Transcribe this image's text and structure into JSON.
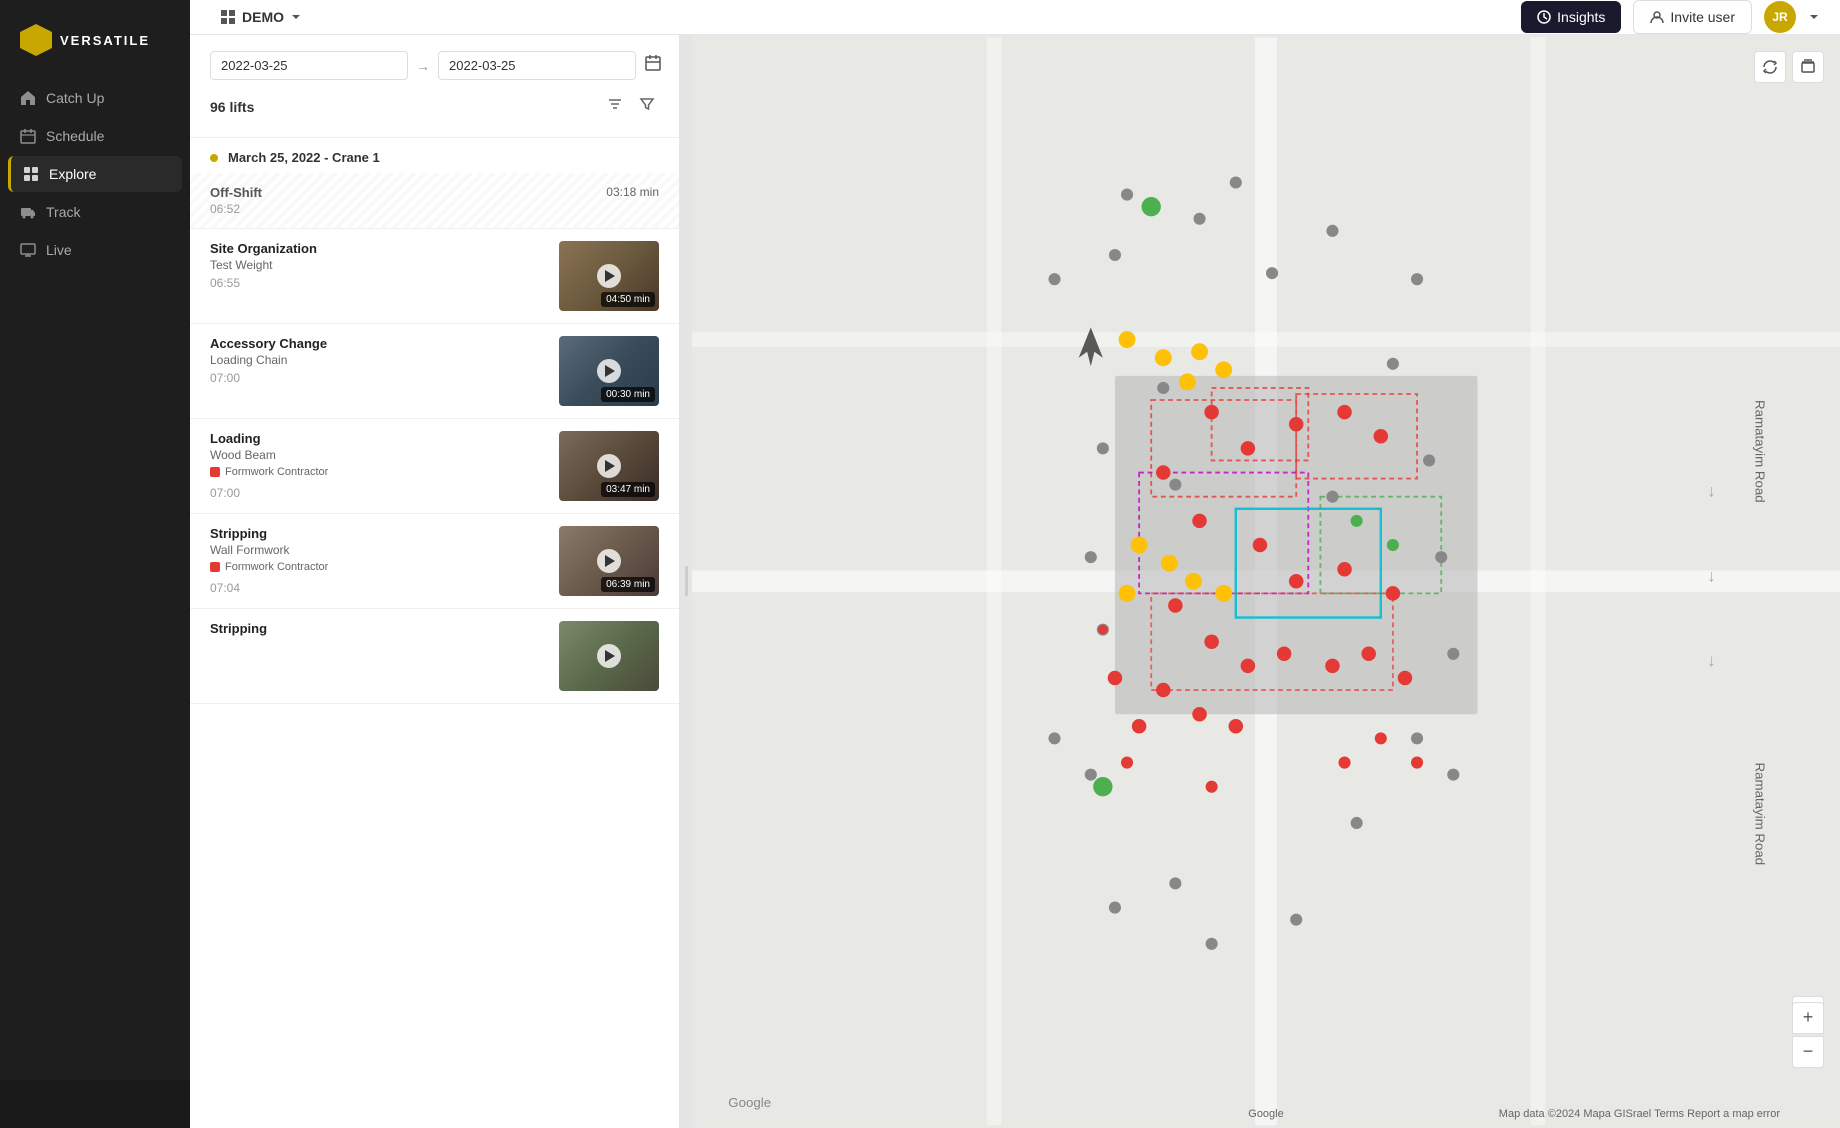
{
  "app": {
    "logo_text": "VERSATILE",
    "project": "DEMO",
    "user_initials": "JR"
  },
  "sidebar": {
    "items": [
      {
        "id": "catch-up",
        "label": "Catch Up",
        "icon": "home"
      },
      {
        "id": "schedule",
        "label": "Schedule",
        "icon": "calendar"
      },
      {
        "id": "explore",
        "label": "Explore",
        "icon": "grid",
        "active": true
      },
      {
        "id": "track",
        "label": "Track",
        "icon": "truck"
      },
      {
        "id": "live",
        "label": "Live",
        "icon": "monitor"
      }
    ]
  },
  "topbar": {
    "project_label": "DEMO",
    "insights_label": "Insights",
    "invite_label": "Invite user",
    "user_initials": "JR"
  },
  "lift_panel": {
    "date_from": "2022-03-25",
    "date_to": "2022-03-25",
    "lifts_count": "96 lifts",
    "group_label": "March 25, 2022 - Crane 1",
    "off_shift": {
      "label": "Off-Shift",
      "time": "06:52",
      "duration": "03:18 min"
    },
    "lifts": [
      {
        "type": "Site Organization",
        "subtype": "Test Weight",
        "time": "06:55",
        "duration": "04:50 min",
        "thumb_class": "thumb-org",
        "has_tag": false,
        "tag_label": "",
        "tag_color": ""
      },
      {
        "type": "Accessory Change",
        "subtype": "Loading Chain",
        "time": "07:00",
        "duration": "00:30 min",
        "thumb_class": "thumb-acc",
        "has_tag": false,
        "tag_label": "",
        "tag_color": ""
      },
      {
        "type": "Loading",
        "subtype": "Wood Beam",
        "time": "07:00",
        "duration": "03:47 min",
        "thumb_class": "thumb-load",
        "has_tag": true,
        "tag_label": "Formwork Contractor",
        "tag_color": "#e53935"
      },
      {
        "type": "Stripping",
        "subtype": "Wall Formwork",
        "time": "07:04",
        "duration": "06:39 min",
        "thumb_class": "thumb-strip",
        "has_tag": true,
        "tag_label": "Formwork Contractor",
        "tag_color": "#e53935"
      },
      {
        "type": "Stripping",
        "subtype": "",
        "time": "",
        "duration": "",
        "thumb_class": "thumb-strip2",
        "has_tag": false,
        "tag_label": "",
        "tag_color": ""
      }
    ]
  },
  "map": {
    "zoom_in_label": "+",
    "zoom_out_label": "−",
    "footer_left": "Google",
    "footer_right": "Map data ©2024 Mapa GISrael   Terms   Report a map error"
  }
}
